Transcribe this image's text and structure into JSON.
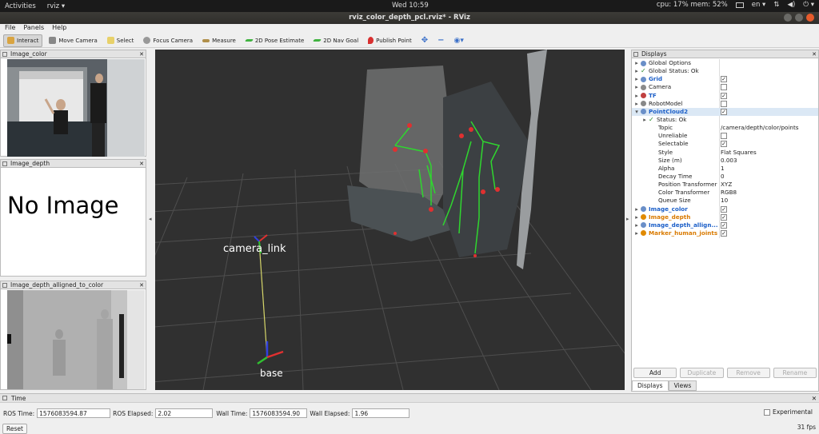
{
  "topbar": {
    "activities": "Activities",
    "app": "rviz ▾",
    "clock": "Wed 10:59",
    "cpu": "cpu: 17% mem: 52%",
    "lang": "en ▾"
  },
  "window": {
    "title": "rviz_color_depth_pcl.rviz* - RViz"
  },
  "menu": [
    "File",
    "Panels",
    "Help"
  ],
  "toolbar": [
    {
      "label": "Interact",
      "icon": "interact-icon",
      "color": "#d9a441"
    },
    {
      "label": "Move Camera",
      "icon": "move-camera-icon",
      "color": "#888888"
    },
    {
      "label": "Select",
      "icon": "select-icon",
      "color": "#e8d16a"
    },
    {
      "label": "Focus Camera",
      "icon": "focus-camera-icon",
      "color": "#999999"
    },
    {
      "label": "Measure",
      "icon": "measure-icon",
      "color": "#b08f4a"
    },
    {
      "label": "2D Pose Estimate",
      "icon": "pose-estimate-icon",
      "color": "#41b341"
    },
    {
      "label": "2D Nav Goal",
      "icon": "nav-goal-icon",
      "color": "#41b341"
    },
    {
      "label": "Publish Point",
      "icon": "publish-point-icon",
      "color": "#d83030"
    }
  ],
  "panels": {
    "image_color": "Image_color",
    "image_depth": "Image_depth",
    "no_image": "No Image",
    "image_depth_aligned": "Image_depth_alligned_to_color"
  },
  "viewport": {
    "camera_link": "camera_link",
    "base": "base"
  },
  "displays": {
    "title": "Displays",
    "rows": [
      {
        "label": "Global Options",
        "value": "",
        "style": "",
        "indent": 0,
        "expander": "▸",
        "icon": "global-options-icon",
        "iconColor": "#6a8fc8",
        "check": null
      },
      {
        "label": "Global Status: Ok",
        "value": "",
        "style": "",
        "indent": 0,
        "expander": "▸",
        "icon": "ok-check-icon",
        "iconColor": "",
        "check": null,
        "glyph": "✓"
      },
      {
        "label": "Grid",
        "value": "",
        "style": "blue",
        "indent": 0,
        "expander": "▸",
        "icon": "grid-icon",
        "iconColor": "#6a8fc8",
        "check": "✓"
      },
      {
        "label": "Camera",
        "value": "",
        "style": "",
        "indent": 0,
        "expander": "▸",
        "icon": "camera-icon",
        "iconColor": "#8a8a8a",
        "check": ""
      },
      {
        "label": "TF",
        "value": "",
        "style": "blue",
        "indent": 0,
        "expander": "▸",
        "icon": "tf-icon",
        "iconColor": "#c04040",
        "check": "✓"
      },
      {
        "label": "RobotModel",
        "value": "",
        "style": "",
        "indent": 0,
        "expander": "▸",
        "icon": "robot-model-icon",
        "iconColor": "#888888",
        "check": ""
      },
      {
        "label": "PointCloud2",
        "value": "",
        "style": "blue",
        "indent": 0,
        "expander": "▾",
        "icon": "pointcloud-icon",
        "iconColor": "#6a8fc8",
        "check": "✓",
        "selected": true
      },
      {
        "label": "Status: Ok",
        "value": "",
        "style": "",
        "indent": 1,
        "expander": "▸",
        "icon": "ok-check-icon",
        "iconColor": "",
        "check": null,
        "glyph": "✓"
      },
      {
        "label": "Topic",
        "value": "/camera/depth/color/points",
        "style": "",
        "indent": 1,
        "expander": "",
        "icon": "",
        "check": null
      },
      {
        "label": "Unreliable",
        "value": "",
        "style": "",
        "indent": 1,
        "expander": "",
        "icon": "",
        "check": ""
      },
      {
        "label": "Selectable",
        "value": "",
        "style": "",
        "indent": 1,
        "expander": "",
        "icon": "",
        "check": "✓"
      },
      {
        "label": "Style",
        "value": "Flat Squares",
        "style": "",
        "indent": 1,
        "expander": "",
        "icon": "",
        "check": null
      },
      {
        "label": "Size (m)",
        "value": "0.003",
        "style": "",
        "indent": 1,
        "expander": "",
        "icon": "",
        "check": null
      },
      {
        "label": "Alpha",
        "value": "1",
        "style": "",
        "indent": 1,
        "expander": "",
        "icon": "",
        "check": null
      },
      {
        "label": "Decay Time",
        "value": "0",
        "style": "",
        "indent": 1,
        "expander": "",
        "icon": "",
        "check": null
      },
      {
        "label": "Position Transformer",
        "value": "XYZ",
        "style": "",
        "indent": 1,
        "expander": "",
        "icon": "",
        "check": null
      },
      {
        "label": "Color Transformer",
        "value": "RGB8",
        "style": "",
        "indent": 1,
        "expander": "",
        "icon": "",
        "check": null
      },
      {
        "label": "Queue Size",
        "value": "10",
        "style": "",
        "indent": 1,
        "expander": "",
        "icon": "",
        "check": null
      },
      {
        "label": "Image_color",
        "value": "",
        "style": "blue",
        "indent": 0,
        "expander": "▸",
        "icon": "image-icon",
        "iconColor": "#6a8fc8",
        "check": "✓"
      },
      {
        "label": "Image_depth",
        "value": "",
        "style": "orange",
        "indent": 0,
        "expander": "▸",
        "icon": "warning-icon",
        "iconColor": "#e08a00",
        "check": "✓"
      },
      {
        "label": "Image_depth_allign...",
        "value": "",
        "style": "blue",
        "indent": 0,
        "expander": "▸",
        "icon": "image-icon",
        "iconColor": "#6a8fc8",
        "check": "✓"
      },
      {
        "label": "Marker_human_joints",
        "value": "",
        "style": "orange",
        "indent": 0,
        "expander": "▸",
        "icon": "warning-icon",
        "iconColor": "#e08a00",
        "check": "✓"
      }
    ],
    "buttons": {
      "add": "Add",
      "duplicate": "Duplicate",
      "remove": "Remove",
      "rename": "Rename"
    },
    "tabs": {
      "displays": "Displays",
      "views": "Views"
    }
  },
  "time": {
    "title": "Time",
    "ros_time_label": "ROS Time:",
    "ros_time": "1576083594.87",
    "ros_elapsed_label": "ROS Elapsed:",
    "ros_elapsed": "2.02",
    "wall_time_label": "Wall Time:",
    "wall_time": "1576083594.90",
    "wall_elapsed_label": "Wall Elapsed:",
    "wall_elapsed": "1.96",
    "experimental": "Experimental",
    "reset": "Reset",
    "fps": "31 fps"
  }
}
